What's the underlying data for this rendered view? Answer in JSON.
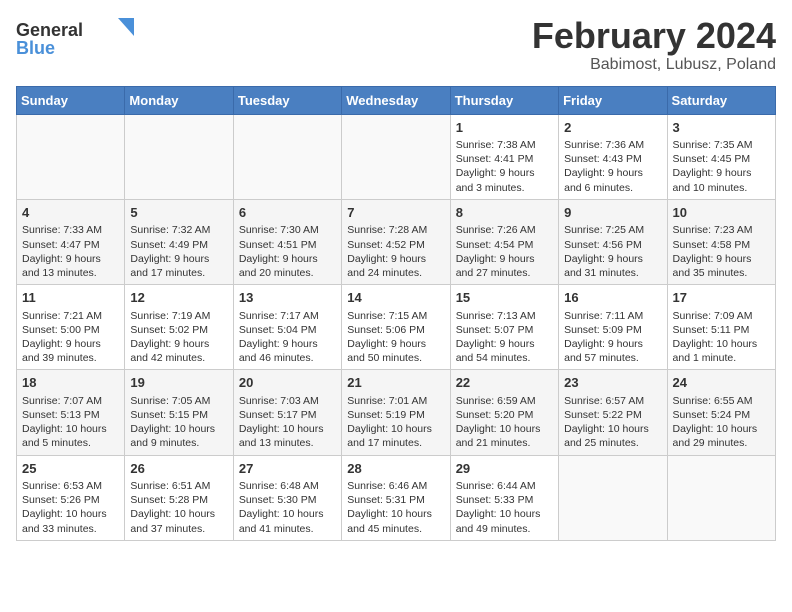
{
  "logo": {
    "line1": "General",
    "line2": "Blue"
  },
  "title": "February 2024",
  "subtitle": "Babimost, Lubusz, Poland",
  "days_header": [
    "Sunday",
    "Monday",
    "Tuesday",
    "Wednesday",
    "Thursday",
    "Friday",
    "Saturday"
  ],
  "weeks": [
    [
      {
        "num": "",
        "text": ""
      },
      {
        "num": "",
        "text": ""
      },
      {
        "num": "",
        "text": ""
      },
      {
        "num": "",
        "text": ""
      },
      {
        "num": "1",
        "text": "Sunrise: 7:38 AM\nSunset: 4:41 PM\nDaylight: 9 hours\nand 3 minutes."
      },
      {
        "num": "2",
        "text": "Sunrise: 7:36 AM\nSunset: 4:43 PM\nDaylight: 9 hours\nand 6 minutes."
      },
      {
        "num": "3",
        "text": "Sunrise: 7:35 AM\nSunset: 4:45 PM\nDaylight: 9 hours\nand 10 minutes."
      }
    ],
    [
      {
        "num": "4",
        "text": "Sunrise: 7:33 AM\nSunset: 4:47 PM\nDaylight: 9 hours\nand 13 minutes."
      },
      {
        "num": "5",
        "text": "Sunrise: 7:32 AM\nSunset: 4:49 PM\nDaylight: 9 hours\nand 17 minutes."
      },
      {
        "num": "6",
        "text": "Sunrise: 7:30 AM\nSunset: 4:51 PM\nDaylight: 9 hours\nand 20 minutes."
      },
      {
        "num": "7",
        "text": "Sunrise: 7:28 AM\nSunset: 4:52 PM\nDaylight: 9 hours\nand 24 minutes."
      },
      {
        "num": "8",
        "text": "Sunrise: 7:26 AM\nSunset: 4:54 PM\nDaylight: 9 hours\nand 27 minutes."
      },
      {
        "num": "9",
        "text": "Sunrise: 7:25 AM\nSunset: 4:56 PM\nDaylight: 9 hours\nand 31 minutes."
      },
      {
        "num": "10",
        "text": "Sunrise: 7:23 AM\nSunset: 4:58 PM\nDaylight: 9 hours\nand 35 minutes."
      }
    ],
    [
      {
        "num": "11",
        "text": "Sunrise: 7:21 AM\nSunset: 5:00 PM\nDaylight: 9 hours\nand 39 minutes."
      },
      {
        "num": "12",
        "text": "Sunrise: 7:19 AM\nSunset: 5:02 PM\nDaylight: 9 hours\nand 42 minutes."
      },
      {
        "num": "13",
        "text": "Sunrise: 7:17 AM\nSunset: 5:04 PM\nDaylight: 9 hours\nand 46 minutes."
      },
      {
        "num": "14",
        "text": "Sunrise: 7:15 AM\nSunset: 5:06 PM\nDaylight: 9 hours\nand 50 minutes."
      },
      {
        "num": "15",
        "text": "Sunrise: 7:13 AM\nSunset: 5:07 PM\nDaylight: 9 hours\nand 54 minutes."
      },
      {
        "num": "16",
        "text": "Sunrise: 7:11 AM\nSunset: 5:09 PM\nDaylight: 9 hours\nand 57 minutes."
      },
      {
        "num": "17",
        "text": "Sunrise: 7:09 AM\nSunset: 5:11 PM\nDaylight: 10 hours\nand 1 minute."
      }
    ],
    [
      {
        "num": "18",
        "text": "Sunrise: 7:07 AM\nSunset: 5:13 PM\nDaylight: 10 hours\nand 5 minutes."
      },
      {
        "num": "19",
        "text": "Sunrise: 7:05 AM\nSunset: 5:15 PM\nDaylight: 10 hours\nand 9 minutes."
      },
      {
        "num": "20",
        "text": "Sunrise: 7:03 AM\nSunset: 5:17 PM\nDaylight: 10 hours\nand 13 minutes."
      },
      {
        "num": "21",
        "text": "Sunrise: 7:01 AM\nSunset: 5:19 PM\nDaylight: 10 hours\nand 17 minutes."
      },
      {
        "num": "22",
        "text": "Sunrise: 6:59 AM\nSunset: 5:20 PM\nDaylight: 10 hours\nand 21 minutes."
      },
      {
        "num": "23",
        "text": "Sunrise: 6:57 AM\nSunset: 5:22 PM\nDaylight: 10 hours\nand 25 minutes."
      },
      {
        "num": "24",
        "text": "Sunrise: 6:55 AM\nSunset: 5:24 PM\nDaylight: 10 hours\nand 29 minutes."
      }
    ],
    [
      {
        "num": "25",
        "text": "Sunrise: 6:53 AM\nSunset: 5:26 PM\nDaylight: 10 hours\nand 33 minutes."
      },
      {
        "num": "26",
        "text": "Sunrise: 6:51 AM\nSunset: 5:28 PM\nDaylight: 10 hours\nand 37 minutes."
      },
      {
        "num": "27",
        "text": "Sunrise: 6:48 AM\nSunset: 5:30 PM\nDaylight: 10 hours\nand 41 minutes."
      },
      {
        "num": "28",
        "text": "Sunrise: 6:46 AM\nSunset: 5:31 PM\nDaylight: 10 hours\nand 45 minutes."
      },
      {
        "num": "29",
        "text": "Sunrise: 6:44 AM\nSunset: 5:33 PM\nDaylight: 10 hours\nand 49 minutes."
      },
      {
        "num": "",
        "text": ""
      },
      {
        "num": "",
        "text": ""
      }
    ]
  ]
}
